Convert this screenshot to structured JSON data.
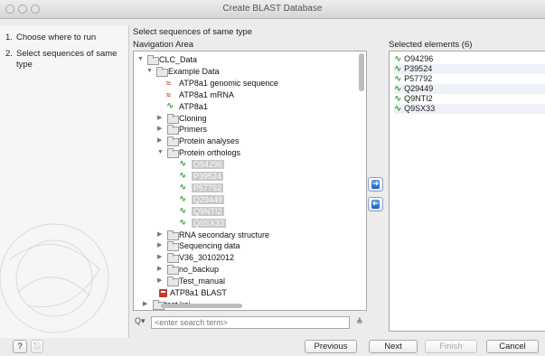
{
  "window": {
    "title": "Create BLAST Database"
  },
  "steps": [
    {
      "num": "1.",
      "text": "Choose where to run"
    },
    {
      "num": "2.",
      "text": "Select sequences of same type"
    }
  ],
  "main": {
    "instruction": "Select sequences of same type",
    "nav_label": "Navigation Area",
    "selected_label": "Selected elements (6)"
  },
  "tree": [
    {
      "label": "CLC_Data",
      "icon": "folder-icon",
      "twisty": "▼"
    },
    {
      "label": "Example Data",
      "icon": "folder-icon",
      "twisty": "▼"
    },
    {
      "label": "ATP8a1 genomic sequence",
      "icon": "genomic-sequence-icon"
    },
    {
      "label": "ATP8a1 mRNA",
      "icon": "mrna-icon"
    },
    {
      "label": "ATP8a1",
      "icon": "protein-sequence-icon"
    },
    {
      "label": "Cloning",
      "icon": "folder-icon",
      "twisty": "▶"
    },
    {
      "label": "Primers",
      "icon": "folder-icon",
      "twisty": "▶"
    },
    {
      "label": "Protein analyses",
      "icon": "folder-icon",
      "twisty": "▶"
    },
    {
      "label": "Protein orthologs",
      "icon": "folder-icon",
      "twisty": "▼"
    },
    {
      "label": "O94296",
      "icon": "protein-sequence-icon",
      "selected": true
    },
    {
      "label": "P39524",
      "icon": "protein-sequence-icon",
      "selected": true
    },
    {
      "label": "P57792",
      "icon": "protein-sequence-icon",
      "selected": true
    },
    {
      "label": "Q29449",
      "icon": "protein-sequence-icon",
      "selected": true
    },
    {
      "label": "Q9NTI2",
      "icon": "protein-sequence-icon",
      "selected": true
    },
    {
      "label": "Q9SX33",
      "icon": "protein-sequence-icon",
      "selected": true
    },
    {
      "label": "RNA secondary structure",
      "icon": "folder-icon",
      "twisty": "▶"
    },
    {
      "label": "Sequencing data",
      "icon": "folder-icon",
      "twisty": "▶"
    },
    {
      "label": "V36_30102012",
      "icon": "folder-icon",
      "twisty": "▶"
    },
    {
      "label": "no_backup",
      "icon": "folder-icon",
      "twisty": "▶"
    },
    {
      "label": "Test_manual",
      "icon": "folder-icon",
      "twisty": "▶"
    },
    {
      "label": "ATP8a1 BLAST",
      "icon": "blast-database-icon"
    },
    {
      "label": "test kei",
      "icon": "folder-icon",
      "twisty": "▶"
    }
  ],
  "search": {
    "placeholder": "<enter search term>"
  },
  "selected": [
    "O94296",
    "P39524",
    "P57792",
    "Q29449",
    "Q9NTI2",
    "Q9SX33"
  ],
  "buttons": {
    "help": "?",
    "previous": "Previous",
    "next": "Next",
    "finish": "Finish",
    "cancel": "Cancel"
  },
  "colors": {
    "sequence_icon": "#2e9e2e",
    "mrna_icon": "#d23b2a",
    "arrow_button": "#1f63c1"
  }
}
